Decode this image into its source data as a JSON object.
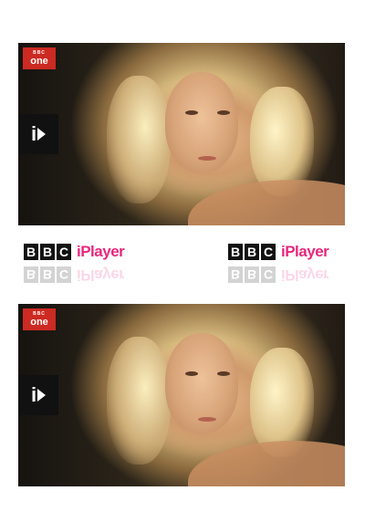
{
  "channel": {
    "top": "BBC",
    "name": "one"
  },
  "iplayer_button": {
    "glyph": "i"
  },
  "brand": {
    "letters": [
      "B",
      "B",
      "C"
    ],
    "product": "iPlayer"
  },
  "colors": {
    "bbc_one_red": "#cc2a22",
    "iplayer_pink": "#e6287c",
    "button_black": "#111111"
  }
}
